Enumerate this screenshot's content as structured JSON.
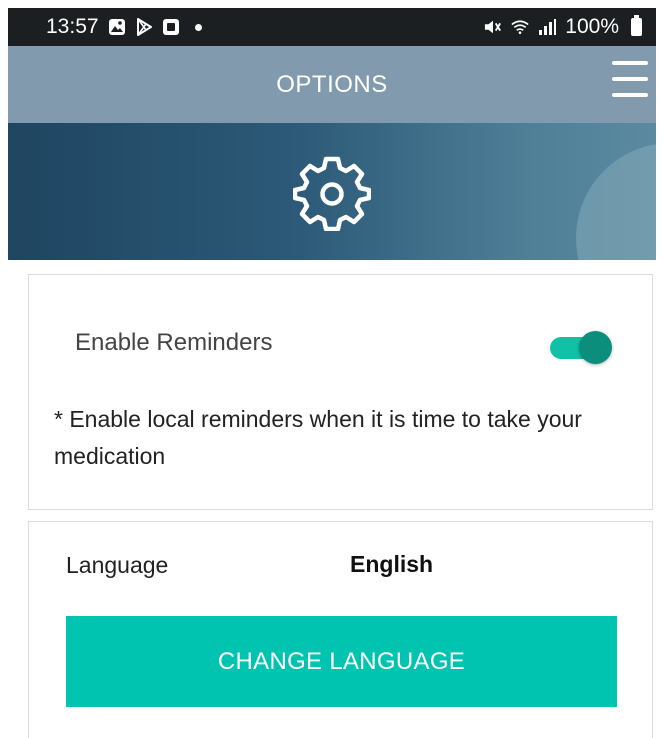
{
  "status_bar": {
    "time": "13:57",
    "left_icons": [
      "gallery-icon",
      "play-store-icon",
      "square-app-icon",
      "dot-icon"
    ],
    "battery_percent": "100%",
    "right_icons": [
      "mute-icon",
      "wifi-icon",
      "signal-icon",
      "battery-icon"
    ]
  },
  "header": {
    "title": "OPTIONS",
    "menu_icon": "hamburger-menu-icon"
  },
  "banner": {
    "icon": "gear-icon"
  },
  "reminders": {
    "label": "Enable Reminders",
    "enabled": true,
    "description": "* Enable local reminders when it is time to take your medication"
  },
  "language": {
    "label": "Language",
    "value": "English",
    "button_label": "CHANGE LANGUAGE"
  },
  "colors": {
    "header_bg": "#819aae",
    "banner_start": "#1f4560",
    "accent": "#00c3b0",
    "toggle_on": "#0b8f7c"
  }
}
